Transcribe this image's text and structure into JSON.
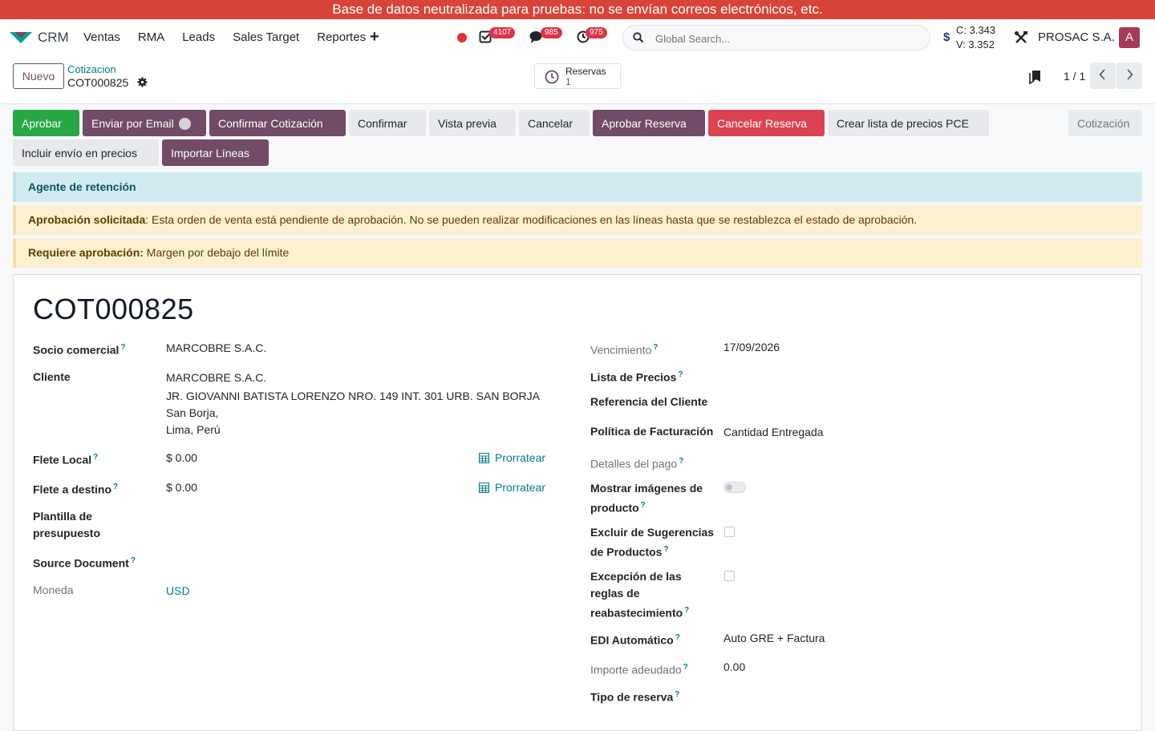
{
  "banner": "Base de datos neutralizada para pruebas: no se envían correos electrónicos, etc.",
  "navbar": {
    "app_name": "CRM",
    "menu": [
      "Ventas",
      "RMA",
      "Leads",
      "Sales Target",
      "Reportes"
    ],
    "badges": {
      "activities": "4107",
      "messages": "985",
      "timers": "975"
    },
    "search_placeholder": "Global Search...",
    "rate_buy": "C: 3.343",
    "rate_sell": "V: 3.352",
    "company": "PROSAC S.A.",
    "avatar_letter": "A"
  },
  "control": {
    "new_label": "Nuevo",
    "breadcrumb_parent": "Cotizacion",
    "breadcrumb_current": "COT000825",
    "reservas_label": "Reservas",
    "reservas_count": "1",
    "pager": "1 / 1"
  },
  "actions": {
    "aprobar": "Aprobar",
    "email": "Enviar por Email",
    "confirmar_cot": "Confirmar Cotización",
    "confirmar": "Confirmar",
    "vista_previa": "Vista previa",
    "cancelar": "Cancelar",
    "aprobar_reserva": "Aprobar Reserva",
    "cancelar_reserva": "Cancelar Reserva",
    "crear_lista": "Crear lista de precios PCE",
    "status": "Cotización",
    "incluir_envio": "Incluir envío en precios",
    "importar": "Importar Líneas"
  },
  "alerts": {
    "info": "Agente de retención",
    "approval_title": "Aprobación solicitada",
    "approval_text": ": Esta orden de venta está pendiente de aprobación. No se pueden realizar modificaciones en las líneas hasta que se restablezca el estado de aprobación.",
    "require_title": "Requiere aprobación:",
    "require_text": " Margen por debajo del límite"
  },
  "form": {
    "title": "COT000825",
    "left": {
      "socio_label": "Socio comercial",
      "socio_value": "MARCOBRE S.A.C.",
      "cliente_label": "Cliente",
      "cliente_name": "MARCOBRE S.A.C.",
      "cliente_addr1": "JR. GIOVANNI BATISTA LORENZO NRO. 149 INT. 301 URB. SAN BORJA",
      "cliente_addr2": "San Borja,",
      "cliente_addr3": "Lima, Perú",
      "flete_local_label": "Flete Local",
      "flete_local_value": "$ 0.00",
      "flete_destino_label": "Flete a destino",
      "flete_destino_value": "$ 0.00",
      "prorratear": "Prorratear",
      "plantilla_label_1": "Plantilla de",
      "plantilla_label_2": "presupuesto",
      "source_label": "Source Document",
      "moneda_label": "Moneda",
      "moneda_value": "USD"
    },
    "right": {
      "vencimiento_label": "Vencimiento",
      "vencimiento_value": "17/09/2026",
      "lista_label": "Lista de Precios",
      "ref_label": "Referencia del Cliente",
      "politica_label": "Política de Facturación",
      "politica_value": "Cantidad Entregada",
      "detalles_label": "Detalles del pago",
      "mostrar_label_1": "Mostrar imágenes de",
      "mostrar_label_2": "producto",
      "excluir_label_1": "Excluir de Sugerencias",
      "excluir_label_2": "de Productos",
      "excepcion_label_1": "Excepción de las",
      "excepcion_label_2": "reglas de",
      "excepcion_label_3": "reabastecimiento",
      "edi_label": "EDI Automático",
      "edi_value": "Auto GRE + Factura",
      "importe_label": "Importe adeudado",
      "importe_value": "0.00",
      "tipo_label": "Tipo de reserva"
    },
    "help_mark": "?"
  }
}
